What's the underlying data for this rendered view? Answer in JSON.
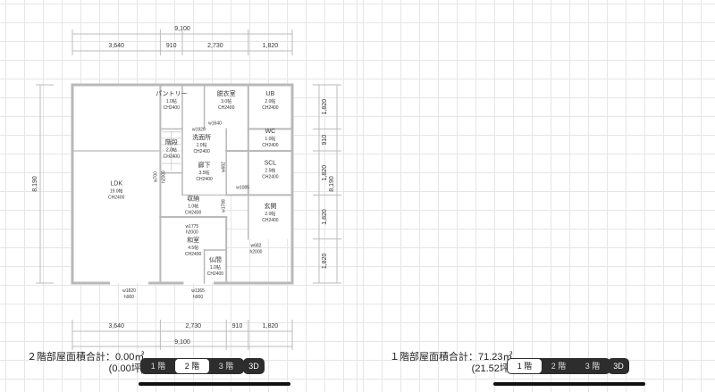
{
  "dimensions": {
    "total": "9,100",
    "segments_top": [
      "3,640",
      "910",
      "2,730",
      "1,820"
    ],
    "segments_bottom": [
      "3,640",
      "2,730",
      "910",
      "1,820"
    ],
    "total_left": "8,190",
    "segments_right": [
      "1,820",
      "910",
      "1,820",
      "1,820",
      "1,820"
    ],
    "total_right": "8,190"
  },
  "rooms": [
    {
      "name": "パントリー",
      "size": "1.0帖",
      "ch": "CH2400"
    },
    {
      "name": "脱衣室",
      "size": "3.0帖",
      "ch": "CH2400"
    },
    {
      "name": "UB",
      "size": "2.0帖",
      "ch": "CH2400"
    },
    {
      "name": "WC",
      "size": "1.0帖",
      "ch": "CH2400"
    },
    {
      "name": "洗面所",
      "size": "1.0帖",
      "ch": "CH2400"
    },
    {
      "name": "SCL",
      "size": "2.5帖",
      "ch": "CH2400"
    },
    {
      "name": "LDK",
      "size": "19.0帖",
      "ch": "CH2400"
    },
    {
      "name": "廊下",
      "size": "3.5帖",
      "ch": "CH2400"
    },
    {
      "name": "収納",
      "size": "1.0帖",
      "ch": "CH2400"
    },
    {
      "name": "玄関",
      "size": "2.0帖",
      "ch": "CH2400"
    },
    {
      "name": "和室",
      "size": "4.5帖",
      "ch": "CH2400"
    },
    {
      "name": "仏間",
      "size": "1.0帖",
      "ch": "CH2400"
    },
    {
      "name": "階段",
      "size": "2.0帖",
      "ch": "CH2400"
    }
  ],
  "openings": {
    "w_ldk_bottom": "w1820",
    "h_ldk_bottom": "h900",
    "w_washitsu_bottom": "w1365",
    "h_washitsu_bottom": "h900",
    "w_butsuma": "w682",
    "h_butsuma": "h2000",
    "w_washitsu_door": "w1775",
    "h_washitsu_door": "h2000",
    "w_hall": "w700",
    "h_hall": "h2000",
    "w_1085": "w1085",
    "w_1640": "w1640",
    "w_682": "w682",
    "w_1788": "w1788",
    "w_1920": "w1920"
  },
  "left_panel": {
    "area_label": "２階部屋面積合計：0.00㎡",
    "area_tsubo": "(0.00坪)"
  },
  "right_panel": {
    "area_label": "１階部屋面積合計：71.23㎡",
    "area_tsubo": "(21.52坪)"
  },
  "floor_tabs": [
    "1 階",
    "2 階",
    "3 階"
  ],
  "left_active_tab": "2 階",
  "right_active_tab": "1 階",
  "button_3d": "3D",
  "colors": {
    "ldk": "#f2e4df",
    "datsui": "#e1e1f6",
    "washitsu": "#dcecdc",
    "genkan": "#f6e1ef",
    "butsuma": "#f6e1ef",
    "hall": "#ededf8",
    "wall": "#111111",
    "wall_faded": "#b9b9b9"
  }
}
